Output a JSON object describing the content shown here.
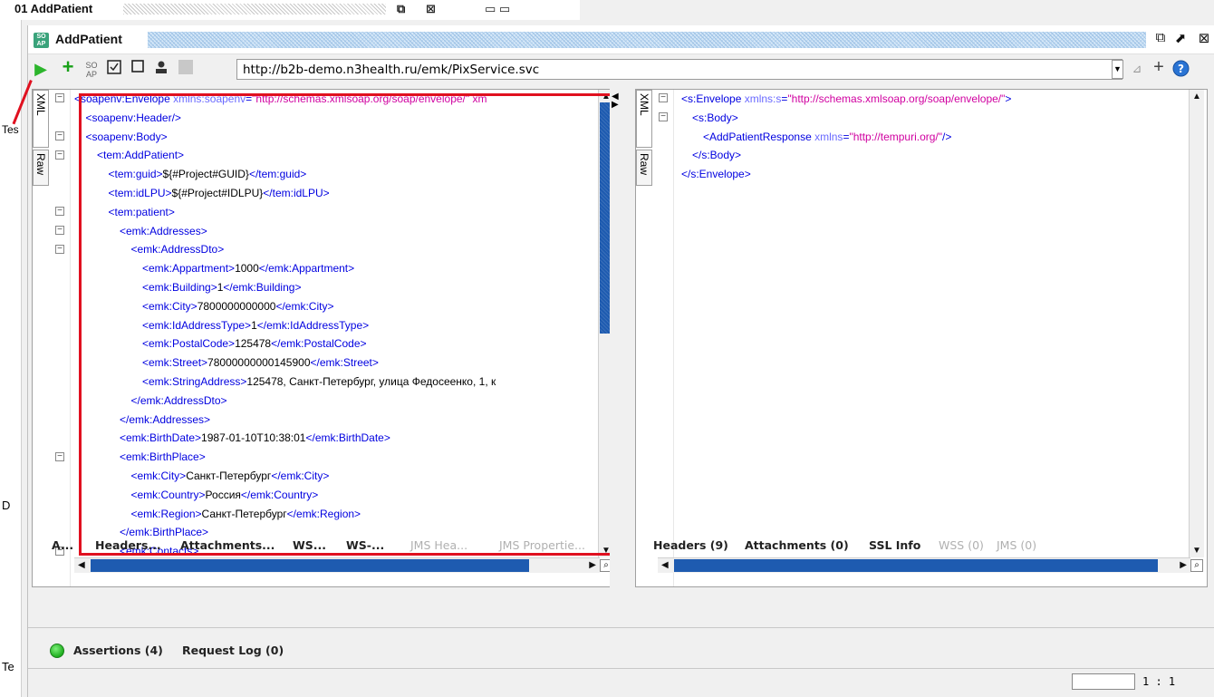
{
  "background_window": {
    "title": "01 AddPatient"
  },
  "left_fragments": [
    "Tes",
    "D",
    "Te"
  ],
  "window": {
    "badge": "SO\nAP",
    "title": "AddPatient"
  },
  "toolbar": {
    "url": "http://b2b-demo.n3health.ru/emk/PixService.svc",
    "icons": [
      "run-icon",
      "add-icon",
      "format-icon",
      "validate-icon",
      "stop-icon",
      "user-icon",
      "square-icon"
    ]
  },
  "request": {
    "tabs": {
      "xml": "XML",
      "raw": "Raw"
    },
    "lines": [
      {
        "indent": 0,
        "html": "<span class=\"tg\">&lt;soapenv:Envelope </span><span class=\"an\">xmlns:soapenv</span><span class=\"tg\">=</span><span class=\"av\">\"http://schemas.xmlsoap.org/soap/envelope/\" xm</span>"
      },
      {
        "indent": 1,
        "html": "<span class=\"tg\">&lt;soapenv:Header/&gt;</span>"
      },
      {
        "indent": 1,
        "html": "<span class=\"tg\">&lt;soapenv:Body&gt;</span>"
      },
      {
        "indent": 2,
        "html": "<span class=\"tg\">&lt;tem:AddPatient&gt;</span>"
      },
      {
        "indent": 3,
        "html": "<span class=\"tg\">&lt;tem:guid&gt;</span><span class=\"tx\">${#Project#GUID}</span><span class=\"tg\">&lt;/tem:guid&gt;</span>"
      },
      {
        "indent": 3,
        "html": "<span class=\"tg\">&lt;tem:idLPU&gt;</span><span class=\"tx\">${#Project#IDLPU}</span><span class=\"tg\">&lt;/tem:idLPU&gt;</span>"
      },
      {
        "indent": 3,
        "html": "<span class=\"tg\">&lt;tem:patient&gt;</span>"
      },
      {
        "indent": 4,
        "html": "<span class=\"tg\">&lt;emk:Addresses&gt;</span>"
      },
      {
        "indent": 5,
        "html": "<span class=\"tg\">&lt;emk:AddressDto&gt;</span>"
      },
      {
        "indent": 6,
        "html": "<span class=\"tg\">&lt;emk:Appartment&gt;</span><span class=\"tx\">1000</span><span class=\"tg\">&lt;/emk:Appartment&gt;</span>"
      },
      {
        "indent": 6,
        "html": "<span class=\"tg\">&lt;emk:Building&gt;</span><span class=\"tx\">1</span><span class=\"tg\">&lt;/emk:Building&gt;</span>"
      },
      {
        "indent": 6,
        "html": "<span class=\"tg\">&lt;emk:City&gt;</span><span class=\"tx\">7800000000000</span><span class=\"tg\">&lt;/emk:City&gt;</span>"
      },
      {
        "indent": 6,
        "html": "<span class=\"tg\">&lt;emk:IdAddressType&gt;</span><span class=\"tx\">1</span><span class=\"tg\">&lt;/emk:IdAddressType&gt;</span>"
      },
      {
        "indent": 6,
        "html": "<span class=\"tg\">&lt;emk:PostalCode&gt;</span><span class=\"tx\">125478</span><span class=\"tg\">&lt;/emk:PostalCode&gt;</span>"
      },
      {
        "indent": 6,
        "html": "<span class=\"tg\">&lt;emk:Street&gt;</span><span class=\"tx\">78000000000145900</span><span class=\"tg\">&lt;/emk:Street&gt;</span>"
      },
      {
        "indent": 6,
        "html": "<span class=\"tg\">&lt;emk:StringAddress&gt;</span><span class=\"tx\">125478, Санкт-Петербург, улица Федосеенко, 1, к</span>"
      },
      {
        "indent": 5,
        "html": "<span class=\"tg\">&lt;/emk:AddressDto&gt;</span>"
      },
      {
        "indent": 4,
        "html": "<span class=\"tg\">&lt;/emk:Addresses&gt;</span>"
      },
      {
        "indent": 4,
        "html": "<span class=\"tg\">&lt;emk:BirthDate&gt;</span><span class=\"tx\">1987-01-10T10:38:01</span><span class=\"tg\">&lt;/emk:BirthDate&gt;</span>"
      },
      {
        "indent": 4,
        "html": "<span class=\"tg\">&lt;emk:BirthPlace&gt;</span>"
      },
      {
        "indent": 5,
        "html": "<span class=\"tg\">&lt;emk:City&gt;</span><span class=\"tx\">Санкт-Петербург</span><span class=\"tg\">&lt;/emk:City&gt;</span>"
      },
      {
        "indent": 5,
        "html": "<span class=\"tg\">&lt;emk:Country&gt;</span><span class=\"tx\">Россия</span><span class=\"tg\">&lt;/emk:Country&gt;</span>"
      },
      {
        "indent": 5,
        "html": "<span class=\"tg\">&lt;emk:Region&gt;</span><span class=\"tx\">Санкт-Петербург</span><span class=\"tg\">&lt;/emk:Region&gt;</span>"
      },
      {
        "indent": 4,
        "html": "<span class=\"tg\">&lt;/emk:BirthPlace&gt;</span>"
      },
      {
        "indent": 4,
        "html": "<span class=\"tg\">&lt;emk:Contacts&gt;</span>"
      }
    ],
    "bottom_tabs": [
      {
        "label": "A...",
        "disabled": false
      },
      {
        "label": "Headers...",
        "disabled": false
      },
      {
        "label": "Attachments...",
        "disabled": false
      },
      {
        "label": "WS...",
        "disabled": false
      },
      {
        "label": "WS-...",
        "disabled": false
      },
      {
        "label": "JMS Hea...",
        "disabled": true
      },
      {
        "label": "JMS Propertie...",
        "disabled": true
      }
    ]
  },
  "response": {
    "tabs": {
      "xml": "XML",
      "raw": "Raw"
    },
    "lines": [
      {
        "indent": 0,
        "html": "<span class=\"tg\">&lt;s:Envelope </span><span class=\"an\">xmlns:s</span><span class=\"tg\">=</span><span class=\"av\">\"http://schemas.xmlsoap.org/soap/envelope/\"</span><span class=\"tg\">&gt;</span>"
      },
      {
        "indent": 1,
        "html": "<span class=\"tg\">&lt;s:Body&gt;</span>"
      },
      {
        "indent": 2,
        "html": "<span class=\"tg\">&lt;AddPatientResponse </span><span class=\"an\">xmlns</span><span class=\"tg\">=</span><span class=\"av\">\"http://tempuri.org/\"</span><span class=\"tg\">/&gt;</span>"
      },
      {
        "indent": 1,
        "html": "<span class=\"tg\">&lt;/s:Body&gt;</span>"
      },
      {
        "indent": 0,
        "html": "<span class=\"tg\">&lt;/s:Envelope&gt;</span>"
      }
    ],
    "bottom_tabs": [
      {
        "label": "Headers (9)",
        "disabled": false
      },
      {
        "label": "Attachments (0)",
        "disabled": false
      },
      {
        "label": "SSL Info",
        "disabled": false
      },
      {
        "label": "WSS (0)",
        "disabled": true
      },
      {
        "label": "JMS (0)",
        "disabled": true
      }
    ]
  },
  "assertions": {
    "assertions_label": "Assertions (4)",
    "request_log_label": "Request Log (0)",
    "status_color": "#1fae1f"
  },
  "status": {
    "zoom": "1 : 1"
  },
  "colors": {
    "tag": "#0000e0",
    "attr_name": "#6a6aff",
    "attr_value": "#d000a0",
    "highlight": "#e0101f",
    "scroll_thumb": "#1e5bb0"
  }
}
